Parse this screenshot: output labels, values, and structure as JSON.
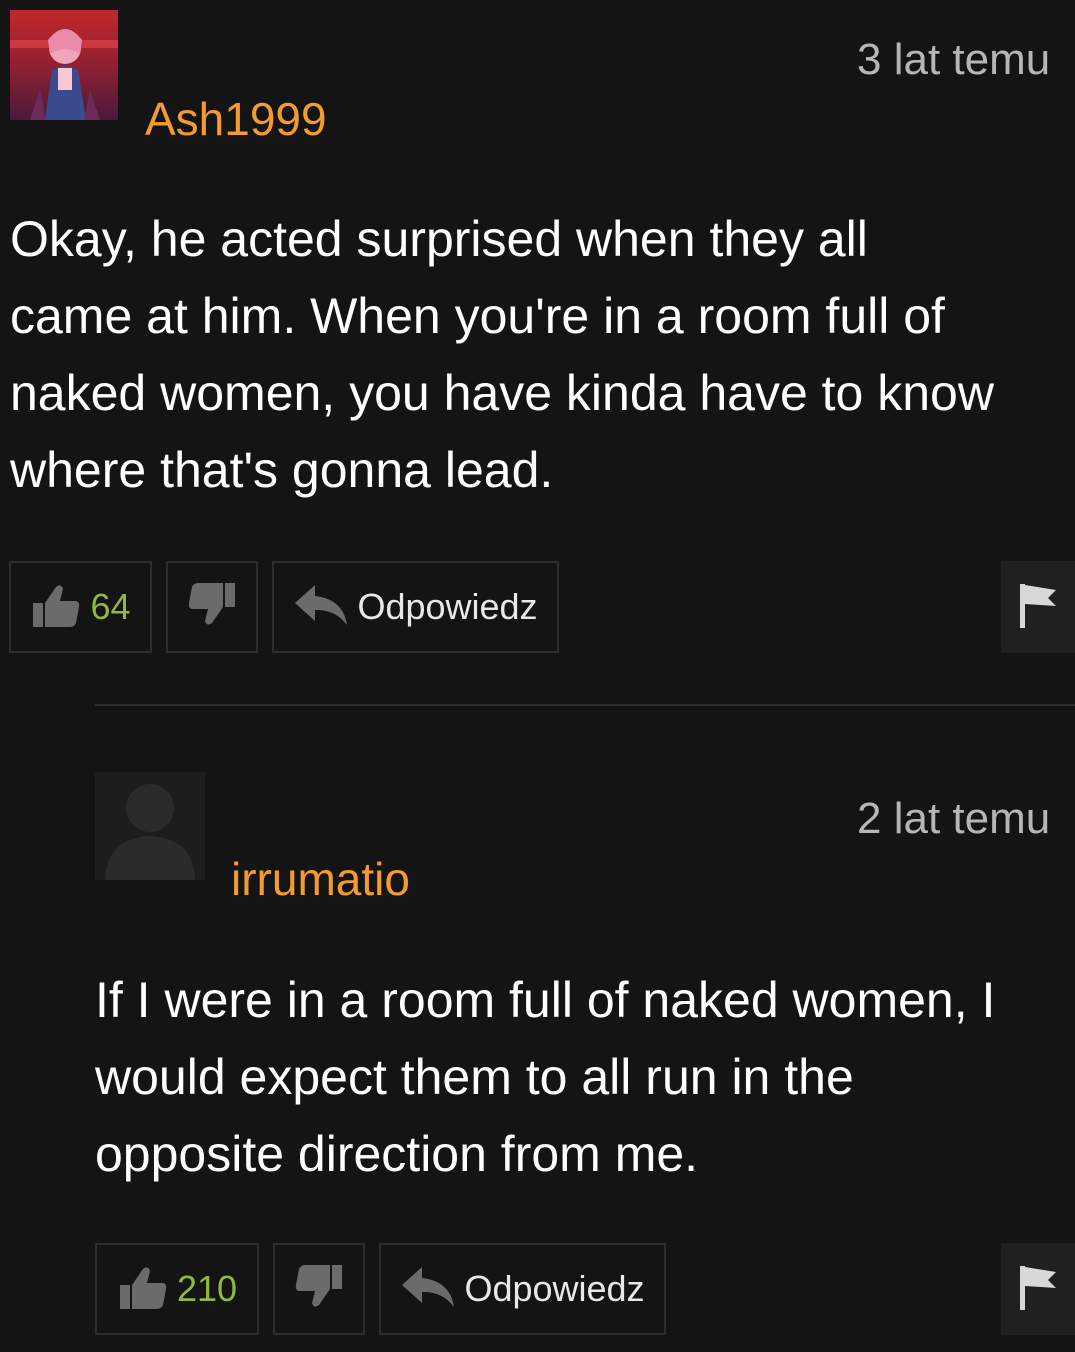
{
  "comments": [
    {
      "username": "Ash1999",
      "timestamp": "3 lat temu",
      "body_lines": [
        "Okay, he acted surprised when they all",
        "came at him. When you're in a room full of",
        "naked women, you have kinda have to know",
        "where that's gonna lead."
      ],
      "likes": "64",
      "reply_label": "Odpowiedz",
      "avatar": "anime-character-avatar"
    },
    {
      "username": "irrumatio",
      "timestamp": "2 lat temu",
      "body_lines": [
        "If I were in a room full of naked women, I",
        "would expect them to all run in the",
        "opposite direction from me."
      ],
      "likes": "210",
      "reply_label": "Odpowiedz",
      "avatar": "default-silhouette-avatar"
    }
  ],
  "icons": {
    "like": "thumbs-up-icon",
    "dislike": "thumbs-down-icon",
    "reply": "reply-arrow-icon",
    "report": "flag-icon"
  },
  "colors": {
    "background": "#141414",
    "username": "#f39b2f",
    "timestamp": "#b6b6b6",
    "like_count": "#8fb83c",
    "text": "#ffffff"
  }
}
